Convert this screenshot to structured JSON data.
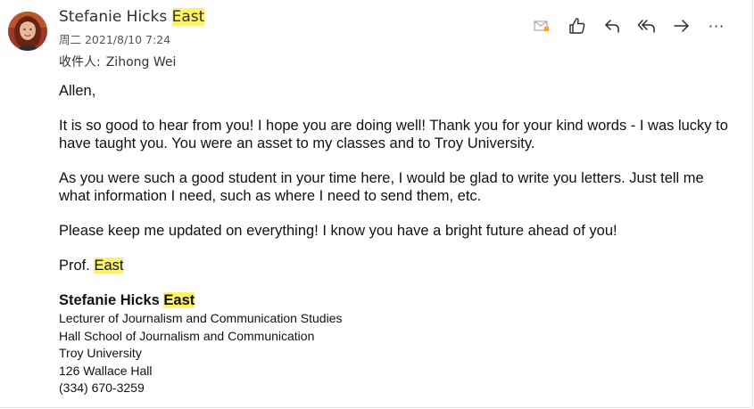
{
  "sender": {
    "name": "Stefanie Hicks",
    "name_highlight": "East",
    "datetime": "周二 2021/8/10 7:24"
  },
  "recipient": {
    "label": "收件人:",
    "name": "Zihong Wei"
  },
  "toolbar": {
    "icons": [
      "mail-read-icon",
      "like-icon",
      "reply-icon",
      "reply-all-icon",
      "forward-icon",
      "more-icon"
    ],
    "more_label": "···"
  },
  "message": {
    "greeting": "Allen,",
    "paragraphs": [
      "It is so good to hear from you! I hope you are doing well! Thank you for your kind words - I was lucky to have taught you. You were an asset to my classes and to Troy University.",
      "As you were such a good student in your time here, I would be glad to write you letters. Just tell me what information I need, such as where I need to send them, etc.",
      "Please keep me updated on everything! I know you have a bright future ahead of you!"
    ],
    "closing_prefix": "Prof.",
    "closing_highlight": "East"
  },
  "signature": {
    "name": "Stefanie Hicks",
    "name_highlight": "East",
    "lines": [
      "Lecturer of Journalism and Communication Studies",
      "Hall School of Journalism and Communication",
      "Troy University",
      "126 Wallace Hall",
      "(334) 670-3259"
    ]
  },
  "colors": {
    "highlight": "#fff26b"
  }
}
